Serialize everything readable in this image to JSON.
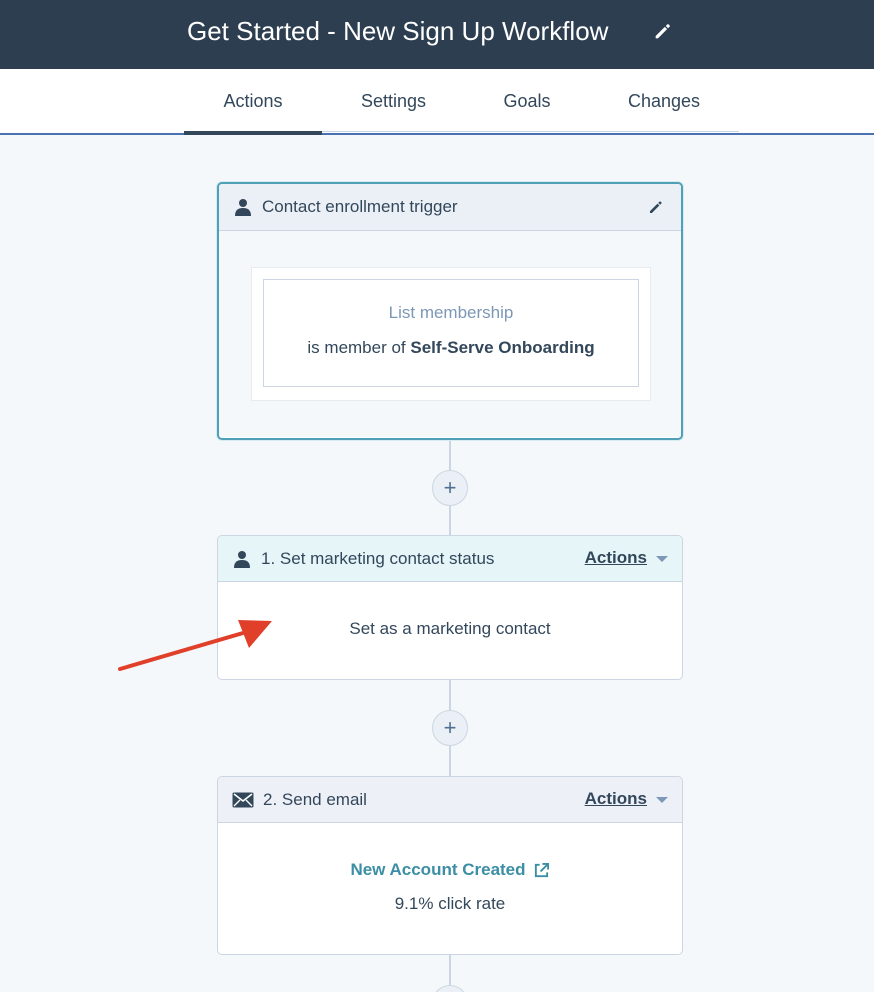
{
  "header": {
    "title": "Get Started - New Sign Up Workflow"
  },
  "tabs": [
    {
      "label": "Actions",
      "active": true
    },
    {
      "label": "Settings",
      "active": false
    },
    {
      "label": "Goals",
      "active": false
    },
    {
      "label": "Changes",
      "active": false
    }
  ],
  "trigger": {
    "title": "Contact enrollment trigger",
    "filter_type": "List membership",
    "condition_prefix": "is member of",
    "condition_value": "Self-Serve Onboarding"
  },
  "steps": [
    {
      "title": "1. Set marketing contact status",
      "actions_label": "Actions",
      "body": "Set as a marketing contact"
    },
    {
      "title": "2. Send email",
      "actions_label": "Actions",
      "email_name": "New Account Created",
      "stat": "9.1% click rate"
    }
  ],
  "add_action_symbol": "+",
  "colors": {
    "topbar": "#2d3e50",
    "accent_teal": "#4f9fb6",
    "link": "#3b8ea5",
    "annotation_arrow": "#e0402a"
  }
}
